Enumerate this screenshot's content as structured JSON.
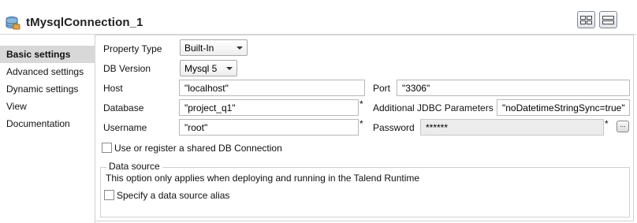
{
  "header": {
    "title": "tMysqlConnection_1",
    "component_icon": "database-icon",
    "buttons": [
      {
        "icon": "grid-layout-icon"
      },
      {
        "icon": "list-layout-icon"
      }
    ]
  },
  "sidebar": {
    "items": [
      {
        "label": "Basic settings",
        "active": true
      },
      {
        "label": "Advanced settings",
        "active": false
      },
      {
        "label": "Dynamic settings",
        "active": false
      },
      {
        "label": "View",
        "active": false
      },
      {
        "label": "Documentation",
        "active": false
      }
    ]
  },
  "form": {
    "property_type": {
      "label": "Property Type",
      "value": "Built-In"
    },
    "db_version": {
      "label": "DB Version",
      "value": "Mysql 5"
    },
    "host": {
      "label": "Host",
      "value": "\"localhost\""
    },
    "port": {
      "label": "Port",
      "value": "\"3306\""
    },
    "database": {
      "label": "Database",
      "value": "\"project_q1\"",
      "required": "*"
    },
    "jdbc": {
      "label": "Additional JDBC Parameters",
      "value": "\"noDatetimeStringSync=true\""
    },
    "username": {
      "label": "Username",
      "value": "\"root\"",
      "required": "*"
    },
    "password": {
      "label": "Password",
      "value": "******",
      "required": "*",
      "button": "..."
    },
    "shared_connection": {
      "label": "Use or register a shared DB Connection",
      "checked": false
    },
    "data_source": {
      "title": "Data source",
      "description": "This option only applies when deploying and running in the Talend Runtime",
      "alias": {
        "label": "Specify a data source alias",
        "checked": false
      }
    }
  }
}
